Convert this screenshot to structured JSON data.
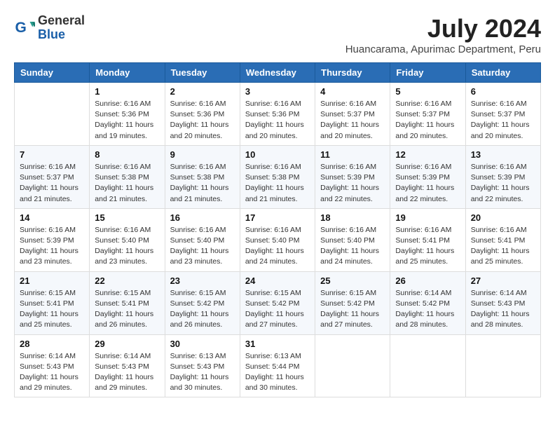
{
  "header": {
    "logo_general": "General",
    "logo_blue": "Blue",
    "month_year": "July 2024",
    "location": "Huancarama, Apurimac Department, Peru"
  },
  "weekdays": [
    "Sunday",
    "Monday",
    "Tuesday",
    "Wednesday",
    "Thursday",
    "Friday",
    "Saturday"
  ],
  "weeks": [
    [
      {
        "day": "",
        "info": ""
      },
      {
        "day": "1",
        "info": "Sunrise: 6:16 AM\nSunset: 5:36 PM\nDaylight: 11 hours\nand 19 minutes."
      },
      {
        "day": "2",
        "info": "Sunrise: 6:16 AM\nSunset: 5:36 PM\nDaylight: 11 hours\nand 20 minutes."
      },
      {
        "day": "3",
        "info": "Sunrise: 6:16 AM\nSunset: 5:36 PM\nDaylight: 11 hours\nand 20 minutes."
      },
      {
        "day": "4",
        "info": "Sunrise: 6:16 AM\nSunset: 5:37 PM\nDaylight: 11 hours\nand 20 minutes."
      },
      {
        "day": "5",
        "info": "Sunrise: 6:16 AM\nSunset: 5:37 PM\nDaylight: 11 hours\nand 20 minutes."
      },
      {
        "day": "6",
        "info": "Sunrise: 6:16 AM\nSunset: 5:37 PM\nDaylight: 11 hours\nand 20 minutes."
      }
    ],
    [
      {
        "day": "7",
        "info": "Sunrise: 6:16 AM\nSunset: 5:37 PM\nDaylight: 11 hours\nand 21 minutes."
      },
      {
        "day": "8",
        "info": "Sunrise: 6:16 AM\nSunset: 5:38 PM\nDaylight: 11 hours\nand 21 minutes."
      },
      {
        "day": "9",
        "info": "Sunrise: 6:16 AM\nSunset: 5:38 PM\nDaylight: 11 hours\nand 21 minutes."
      },
      {
        "day": "10",
        "info": "Sunrise: 6:16 AM\nSunset: 5:38 PM\nDaylight: 11 hours\nand 21 minutes."
      },
      {
        "day": "11",
        "info": "Sunrise: 6:16 AM\nSunset: 5:39 PM\nDaylight: 11 hours\nand 22 minutes."
      },
      {
        "day": "12",
        "info": "Sunrise: 6:16 AM\nSunset: 5:39 PM\nDaylight: 11 hours\nand 22 minutes."
      },
      {
        "day": "13",
        "info": "Sunrise: 6:16 AM\nSunset: 5:39 PM\nDaylight: 11 hours\nand 22 minutes."
      }
    ],
    [
      {
        "day": "14",
        "info": "Sunrise: 6:16 AM\nSunset: 5:39 PM\nDaylight: 11 hours\nand 23 minutes."
      },
      {
        "day": "15",
        "info": "Sunrise: 6:16 AM\nSunset: 5:40 PM\nDaylight: 11 hours\nand 23 minutes."
      },
      {
        "day": "16",
        "info": "Sunrise: 6:16 AM\nSunset: 5:40 PM\nDaylight: 11 hours\nand 23 minutes."
      },
      {
        "day": "17",
        "info": "Sunrise: 6:16 AM\nSunset: 5:40 PM\nDaylight: 11 hours\nand 24 minutes."
      },
      {
        "day": "18",
        "info": "Sunrise: 6:16 AM\nSunset: 5:40 PM\nDaylight: 11 hours\nand 24 minutes."
      },
      {
        "day": "19",
        "info": "Sunrise: 6:16 AM\nSunset: 5:41 PM\nDaylight: 11 hours\nand 25 minutes."
      },
      {
        "day": "20",
        "info": "Sunrise: 6:16 AM\nSunset: 5:41 PM\nDaylight: 11 hours\nand 25 minutes."
      }
    ],
    [
      {
        "day": "21",
        "info": "Sunrise: 6:15 AM\nSunset: 5:41 PM\nDaylight: 11 hours\nand 25 minutes."
      },
      {
        "day": "22",
        "info": "Sunrise: 6:15 AM\nSunset: 5:41 PM\nDaylight: 11 hours\nand 26 minutes."
      },
      {
        "day": "23",
        "info": "Sunrise: 6:15 AM\nSunset: 5:42 PM\nDaylight: 11 hours\nand 26 minutes."
      },
      {
        "day": "24",
        "info": "Sunrise: 6:15 AM\nSunset: 5:42 PM\nDaylight: 11 hours\nand 27 minutes."
      },
      {
        "day": "25",
        "info": "Sunrise: 6:15 AM\nSunset: 5:42 PM\nDaylight: 11 hours\nand 27 minutes."
      },
      {
        "day": "26",
        "info": "Sunrise: 6:14 AM\nSunset: 5:42 PM\nDaylight: 11 hours\nand 28 minutes."
      },
      {
        "day": "27",
        "info": "Sunrise: 6:14 AM\nSunset: 5:43 PM\nDaylight: 11 hours\nand 28 minutes."
      }
    ],
    [
      {
        "day": "28",
        "info": "Sunrise: 6:14 AM\nSunset: 5:43 PM\nDaylight: 11 hours\nand 29 minutes."
      },
      {
        "day": "29",
        "info": "Sunrise: 6:14 AM\nSunset: 5:43 PM\nDaylight: 11 hours\nand 29 minutes."
      },
      {
        "day": "30",
        "info": "Sunrise: 6:13 AM\nSunset: 5:43 PM\nDaylight: 11 hours\nand 30 minutes."
      },
      {
        "day": "31",
        "info": "Sunrise: 6:13 AM\nSunset: 5:44 PM\nDaylight: 11 hours\nand 30 minutes."
      },
      {
        "day": "",
        "info": ""
      },
      {
        "day": "",
        "info": ""
      },
      {
        "day": "",
        "info": ""
      }
    ]
  ]
}
